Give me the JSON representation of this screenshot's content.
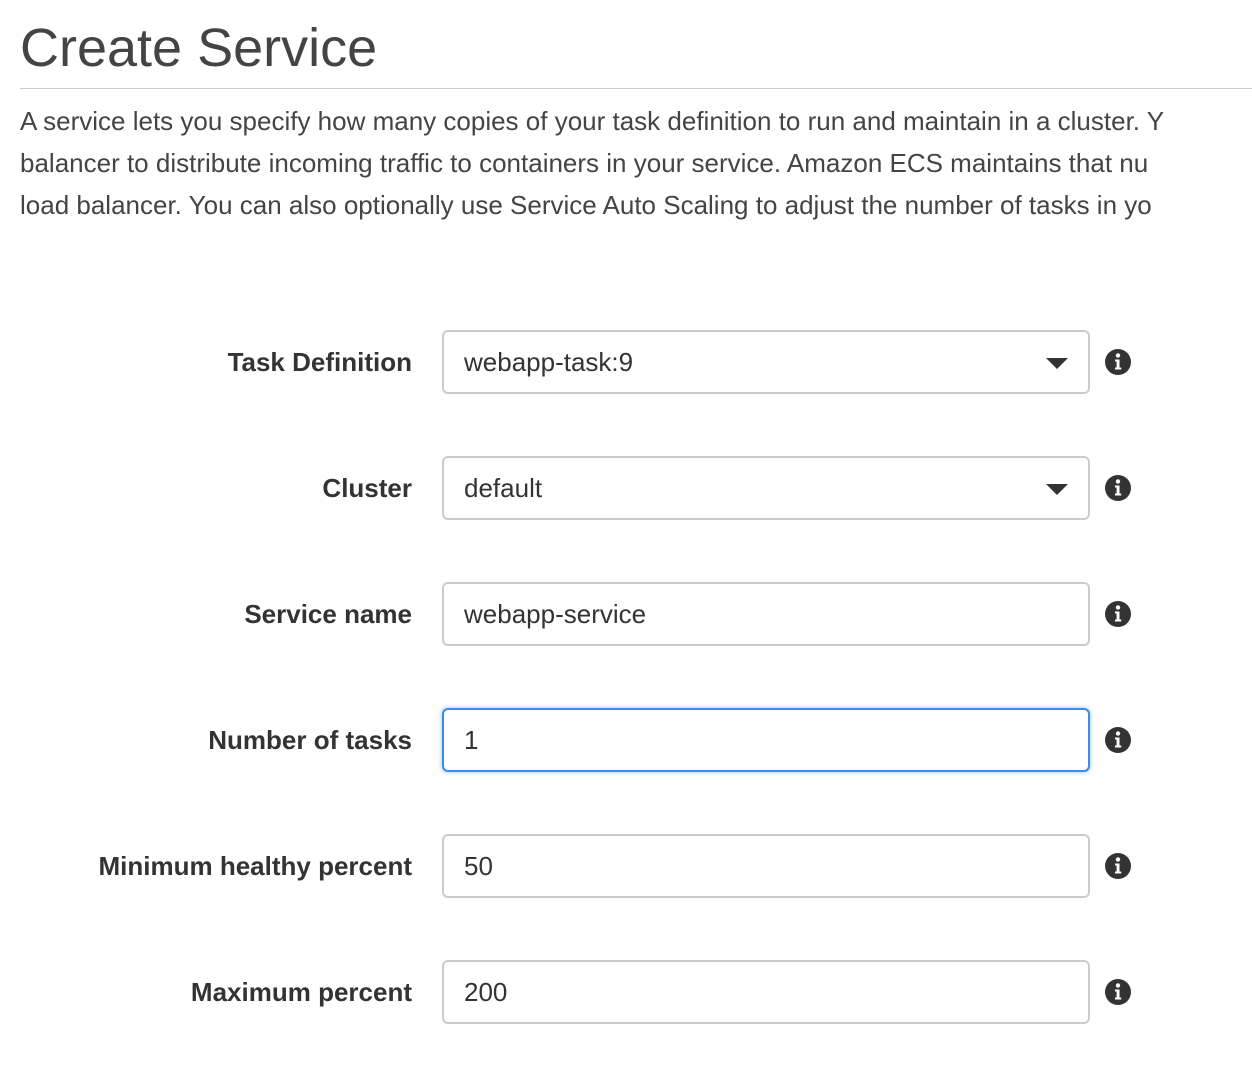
{
  "page": {
    "title": "Create Service",
    "description_lines": [
      "A service lets you specify how many copies of your task definition to run and maintain in a cluster. Y",
      "balancer to distribute incoming traffic to containers in your service. Amazon ECS maintains that nu",
      "load balancer. You can also optionally use Service Auto Scaling to adjust the number of tasks in yo"
    ]
  },
  "form": {
    "task_definition": {
      "label": "Task Definition",
      "value": "webapp-task:9"
    },
    "cluster": {
      "label": "Cluster",
      "value": "default"
    },
    "service_name": {
      "label": "Service name",
      "value": "webapp-service"
    },
    "number_of_tasks": {
      "label": "Number of tasks",
      "value": "1"
    },
    "minimum_healthy_percent": {
      "label": "Minimum healthy percent",
      "value": "50"
    },
    "maximum_percent": {
      "label": "Maximum percent",
      "value": "200"
    }
  },
  "icons": {
    "info": "info-icon",
    "dropdown": "caret-down-icon"
  },
  "colors": {
    "text": "#444444",
    "label": "#333333",
    "border": "#cccccc",
    "focus": "#3b8be8"
  }
}
